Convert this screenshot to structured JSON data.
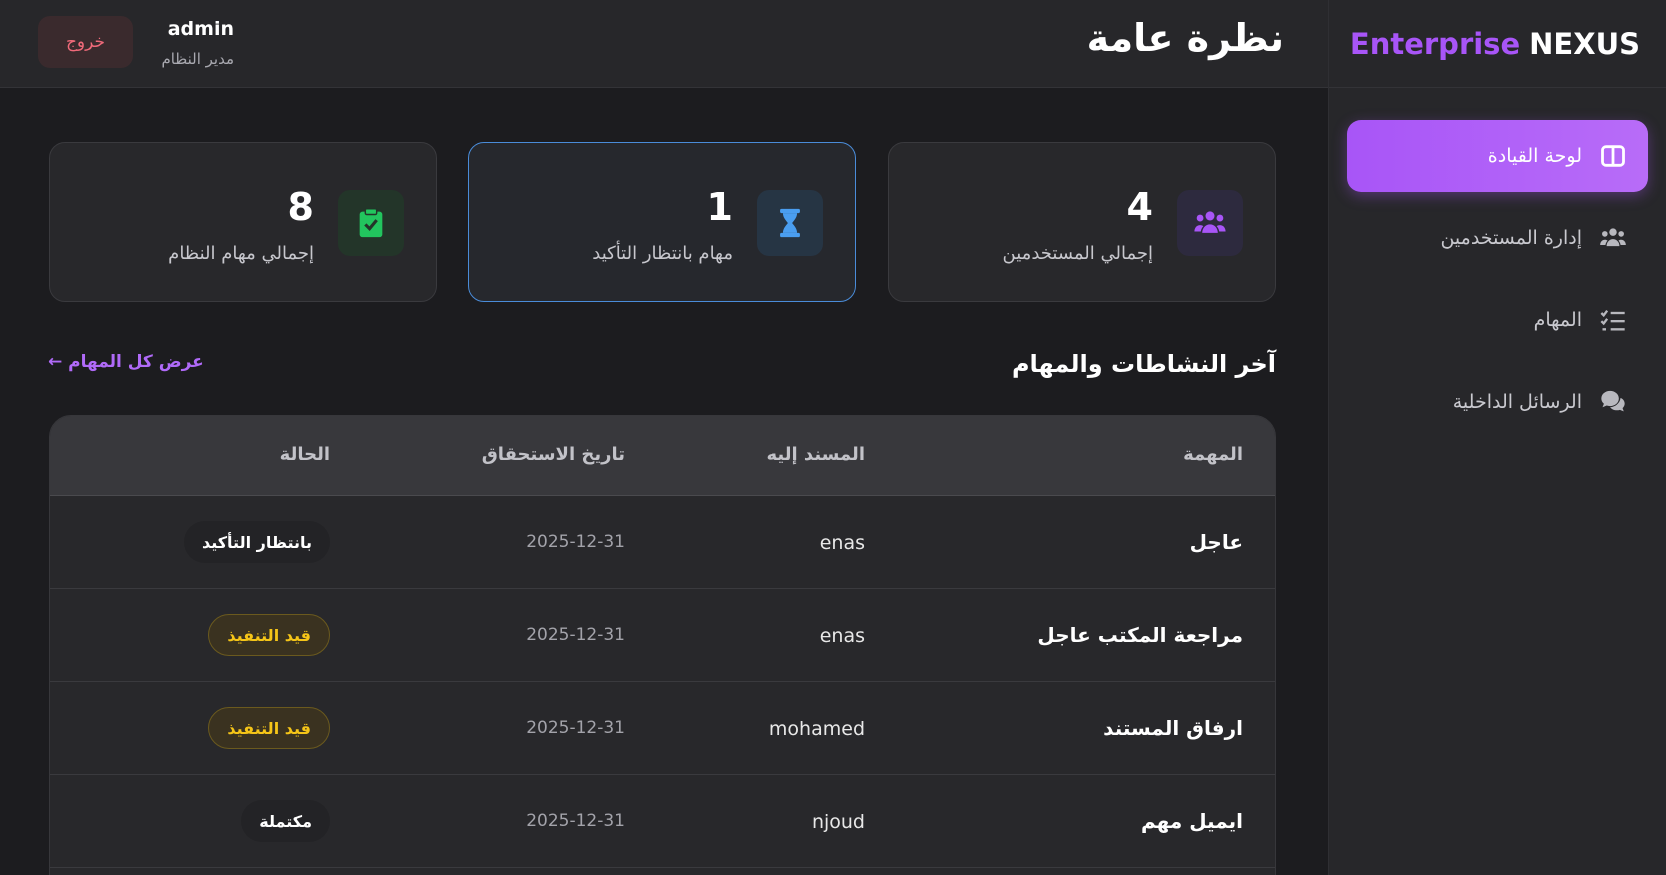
{
  "brand": {
    "word1": "Enterprise",
    "word2": "NEXUS"
  },
  "sidebar": {
    "items": [
      {
        "label": "لوحة القيادة",
        "icon": "dashboard-icon",
        "active": true
      },
      {
        "label": "إدارة المستخدمين",
        "icon": "users-icon",
        "active": false
      },
      {
        "label": "المهام",
        "icon": "tasks-list-icon",
        "active": false
      },
      {
        "label": "الرسائل الداخلية",
        "icon": "chat-icon",
        "active": false
      }
    ]
  },
  "header": {
    "title": "نظرة عامة",
    "user_name": "admin",
    "user_role": "مدير النظام",
    "logout_label": "خروج"
  },
  "stats": [
    {
      "value": "4",
      "label": "إجمالي المستخدمين",
      "icon": "users-icon",
      "color": "#a855f7"
    },
    {
      "value": "1",
      "label": "مهام بانتظار التأكيد",
      "icon": "hourglass-icon",
      "color": "#4a9ef0"
    },
    {
      "value": "8",
      "label": "إجمالي مهام النظام",
      "icon": "clipboard-check-icon",
      "color": "#22c55e"
    }
  ],
  "activity": {
    "title": "آخر النشاطات والمهام",
    "view_all": "← عرض كل المهام",
    "columns": {
      "task": "المهمة",
      "assignee": "المسند إليه",
      "due": "تاريخ الاستحقاق",
      "status": "الحالة"
    },
    "rows": [
      {
        "task": "عاجل",
        "assignee": "enas",
        "due": "2025-12-31",
        "status": "بانتظار التأكيد"
      },
      {
        "task": "مراجعة المكتب عاجل",
        "assignee": "enas",
        "due": "2025-12-31",
        "status": "قيد التنفيذ"
      },
      {
        "task": "ارفاق المستند",
        "assignee": "mohamed",
        "due": "2025-12-31",
        "status": "قيد التنفيذ"
      },
      {
        "task": "ايميل مهم",
        "assignee": "njoud",
        "due": "2025-12-31",
        "status": "مكتملة"
      }
    ]
  }
}
